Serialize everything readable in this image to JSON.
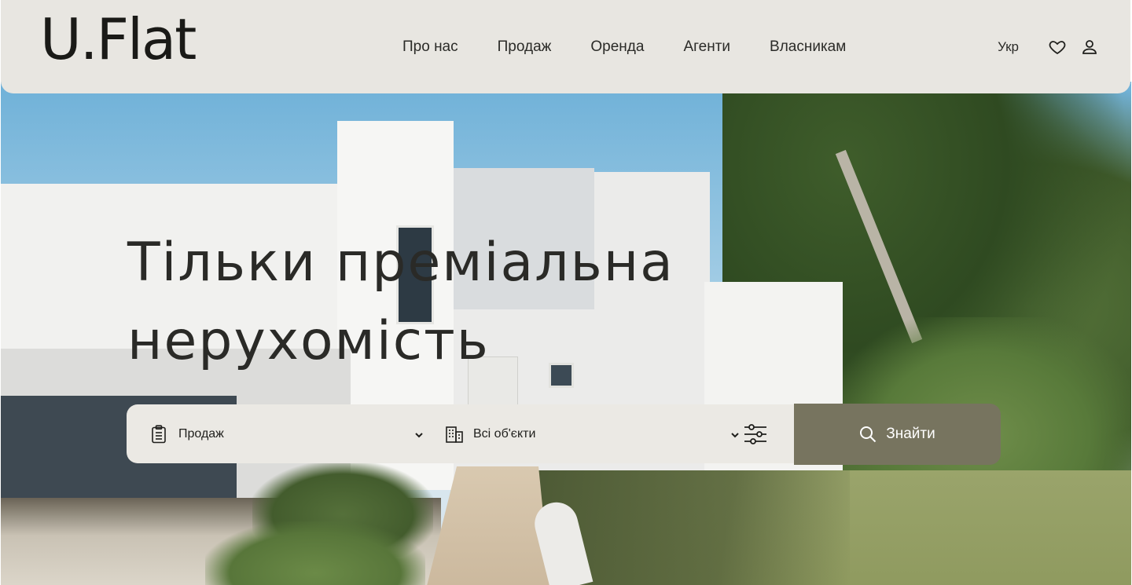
{
  "header": {
    "logo": "U.Flat",
    "nav": [
      "Про нас",
      "Продаж",
      "Оренда",
      "Агенти",
      "Власникам"
    ],
    "language": "Укр",
    "icons": [
      "heart-icon",
      "user-icon"
    ]
  },
  "hero": {
    "title_line1": "Тільки преміальна",
    "title_line2": "нерухомість"
  },
  "search": {
    "deal_type": "Продаж",
    "property_type": "Всі об'єкти",
    "submit_label": "Знайти",
    "icons": [
      "clipboard-icon",
      "building-icon",
      "filter-icon",
      "search-icon"
    ]
  },
  "colors": {
    "header_bg": "#e8e6e1",
    "search_button": "#77745f",
    "text_dark": "#2a2a27"
  }
}
